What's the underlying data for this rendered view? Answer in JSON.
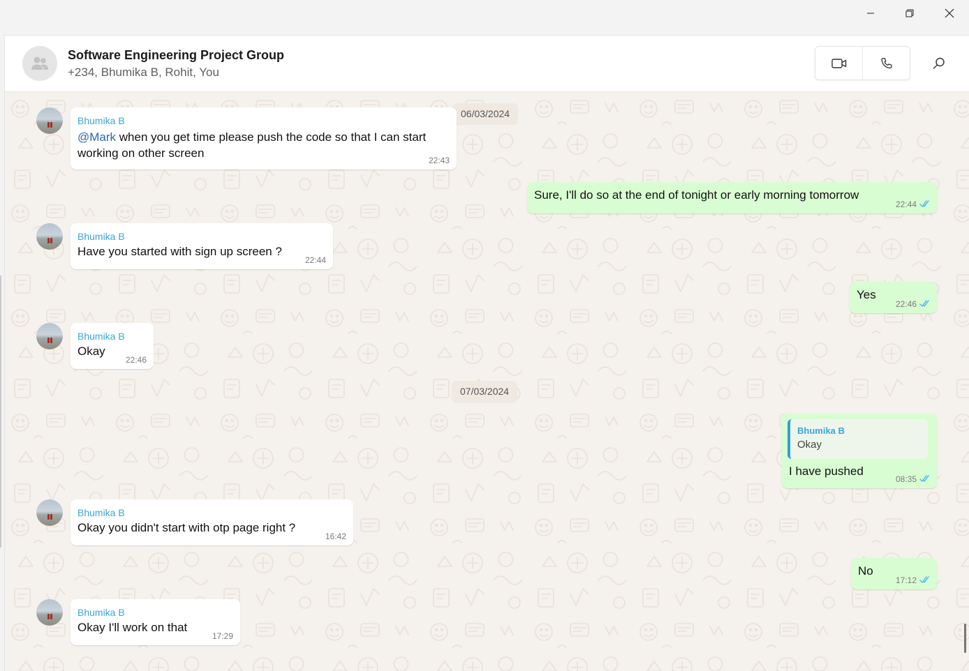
{
  "window": {
    "controls": {
      "minimize": "minimize-icon",
      "restore": "restore-icon",
      "close": "close-icon"
    }
  },
  "header": {
    "title": "Software Engineering Project Group",
    "members": "+234, Bhumika B, Rohit, You",
    "video_call_icon": "video-camera-icon",
    "voice_call_icon": "phone-icon",
    "search_icon": "search-icon"
  },
  "chat": {
    "date_separators": [
      "06/03/2024",
      "07/03/2024"
    ],
    "messages": [
      {
        "direction": "in",
        "sender": "Bhumika B",
        "mention": "@Mark",
        "text_line1": " when you get time please push the code so that I can start",
        "text_line2": "working on other screen",
        "time": "22:43"
      },
      {
        "direction": "out",
        "text": "Sure, I'll do so at the end of tonight or early morning tomorrow",
        "time": "22:44",
        "status": "read"
      },
      {
        "direction": "in",
        "sender": "Bhumika B",
        "text": "Have you started with sign up screen ?",
        "time": "22:44"
      },
      {
        "direction": "out",
        "text": "Yes",
        "time": "22:46",
        "status": "read"
      },
      {
        "direction": "in",
        "sender": "Bhumika B",
        "text": "Okay",
        "time": "22:46"
      },
      {
        "direction": "out",
        "quote": {
          "sender": "Bhumika B",
          "text": "Okay"
        },
        "text": "I have pushed",
        "time": "08:35",
        "status": "read"
      },
      {
        "direction": "in",
        "sender": "Bhumika B",
        "text": "Okay you didn't start with otp page right ?",
        "time": "16:42"
      },
      {
        "direction": "out",
        "text": "No",
        "time": "17:12",
        "status": "read"
      },
      {
        "direction": "in",
        "sender": "Bhumika B",
        "text": "Okay I'll work on that",
        "time": "17:29"
      }
    ]
  },
  "colors": {
    "chat_background": "#f5f1ec",
    "outgoing_bubble": "#d9fdd3",
    "incoming_bubble": "#ffffff",
    "sender_name": "#3aa5d9",
    "mention": "#2768b5",
    "read_ticks": "#53bdeb"
  }
}
